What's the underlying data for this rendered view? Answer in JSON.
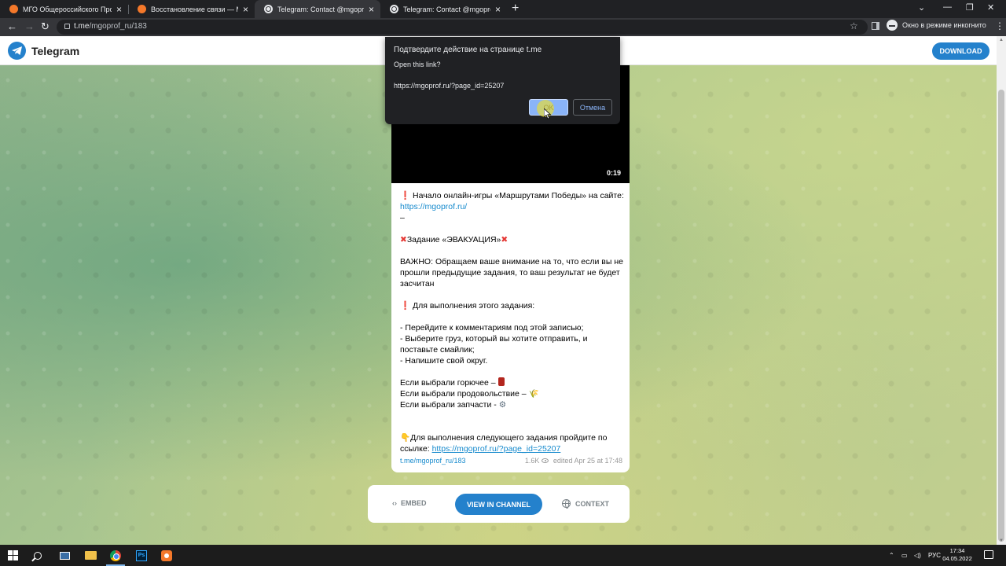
{
  "browser": {
    "tabs": [
      {
        "title": "МГО Общероссийского Профс",
        "icon": "orange-app-icon"
      },
      {
        "title": "Восстановление связи — МГО (",
        "icon": "orange-app-icon"
      },
      {
        "title": "Telegram: Contact @mgoprof_ru",
        "icon": "globe-icon"
      },
      {
        "title": "Telegram: Contact @mgoprof_ru",
        "icon": "globe-icon"
      }
    ],
    "url_host": "t.me",
    "url_path": "/mgoprof_ru/183",
    "incognito_label": "Окно в режиме инкогнито"
  },
  "dialog": {
    "title": "Подтвердите действие на странице t.me",
    "question": "Open this link?",
    "url": "https://mgoprof.ru/?page_id=25207",
    "ok_label": "OK",
    "cancel_label": "Отмена"
  },
  "header": {
    "brand": "Telegram",
    "download_label": "DOWNLOAD"
  },
  "post": {
    "duration": "0:19",
    "line1_text": "Начало онлайн-игры «Маршрутами Победы» на сайте: ",
    "line1_link": "https://mgoprof.ru/",
    "dash": "–",
    "task_title": "Задание «ЭВАКУАЦИЯ»",
    "important": "ВАЖНО: Обращаем ваше внимание на то, что если вы не прошли предыдущие задания, то ваш результат не будет засчитан",
    "howto": "Для выполнения этого задания:",
    "step1": "- Перейдите к комментариям под этой записью;",
    "step2": "- Выберите груз, который вы хотите отправить, и поставьте смайлик;",
    "step3": "- Напишите свой округ.",
    "choice1": "Если выбрали горючее – ",
    "choice2": "Если выбрали продовольствие – ",
    "choice3": "Если выбрали запчасти - ",
    "next_text": "Для выполнения следующего задания пройдите по ссылке: ",
    "next_link": "https://mgoprof.ru/?page_id=25207",
    "meta_link": "t.me/mgoprof_ru/183",
    "views": "1.6K",
    "edited": "edited  Apr 25 at 17:48"
  },
  "bottombar": {
    "embed_label": "EMBED",
    "view_label": "VIEW IN CHANNEL",
    "context_label": "CONTEXT"
  },
  "taskbar": {
    "lang": "РУС",
    "time": "17:34",
    "date": "04.05.2022"
  },
  "colors": {
    "telegram_blue": "#2481cc",
    "link": "#168acd",
    "chrome_dark": "#202124"
  }
}
